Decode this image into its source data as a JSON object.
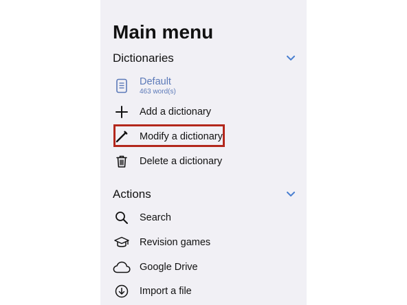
{
  "main_menu": {
    "title": "Main menu"
  },
  "dictionaries": {
    "header": "Dictionaries",
    "expand_icon": "chevron-down-icon",
    "selected_dictionary": {
      "name": "Default",
      "word_count": "463 word(s)",
      "icon": "document-icon"
    },
    "items": [
      {
        "label": "Add a dictionary",
        "icon": "plus-icon"
      },
      {
        "label": "Modify a dictionary",
        "icon": "pencil-icon",
        "highlighted": true
      },
      {
        "label": "Delete a dictionary",
        "icon": "trash-icon"
      }
    ]
  },
  "actions": {
    "header": "Actions",
    "expand_icon": "chevron-down-icon",
    "items": [
      {
        "label": "Search",
        "icon": "search-icon"
      },
      {
        "label": "Revision games",
        "icon": "graduation-cap-icon"
      },
      {
        "label": "Google Drive",
        "icon": "cloud-icon"
      },
      {
        "label": "Import a file",
        "icon": "download-circle-icon"
      }
    ]
  },
  "colors": {
    "panel_background": "#f1f0f5",
    "accent": "#4a7fd0",
    "dictionary_text": "#5b79b8",
    "highlight_border": "#b3271c"
  }
}
